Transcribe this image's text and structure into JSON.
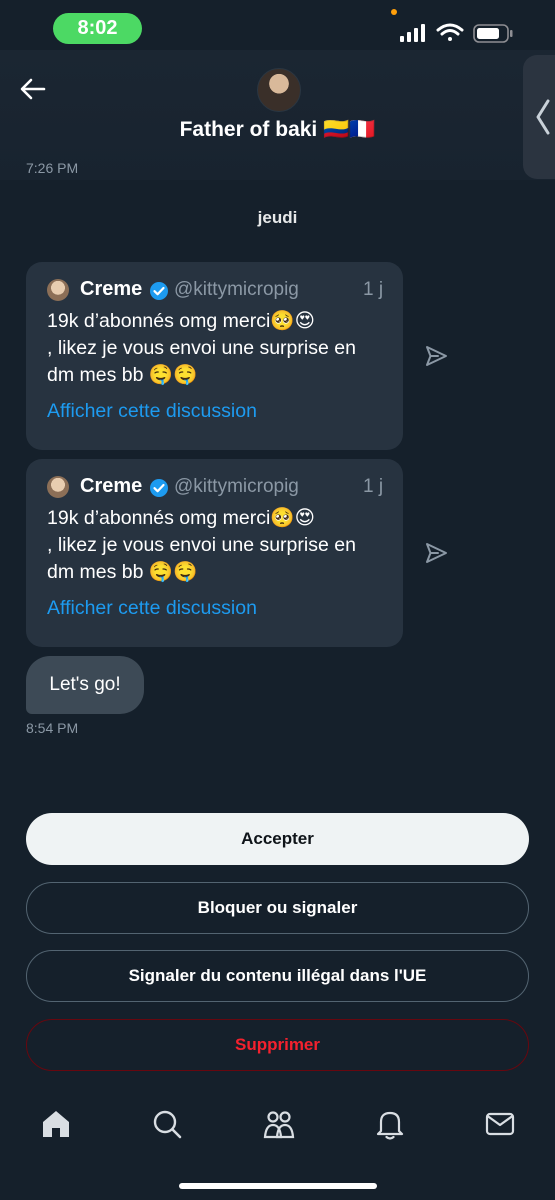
{
  "status_bar": {
    "time": "8:02"
  },
  "header": {
    "back_icon": "arrow-left-icon",
    "contact_name": "Father of baki 🇨🇴🇫🇷",
    "side_handle_icon": "chevron-left-icon"
  },
  "messages": {
    "timestamp_top": "7:26 PM",
    "day_label": "jeudi",
    "shared_tweets": [
      {
        "author": "Creme",
        "handle": "@kittymicropig",
        "age": "1 j",
        "text_line1": "19k d’abonnés omg merci🥺😍",
        "text_line2": ", likez je vous envoi une surprise en",
        "text_line3": "dm mes bb 🤤🤤",
        "link": "Afficher cette discussion"
      },
      {
        "author": "Creme",
        "handle": "@kittymicropig",
        "age": "1 j",
        "text_line1": "19k d’abonnés omg merci🥺😍",
        "text_line2": ", likez je vous envoi une surprise en",
        "text_line3": "dm mes bb 🤤🤤",
        "link": "Afficher cette discussion"
      }
    ],
    "bubble_text": "Let's go!",
    "timestamp_bottom": "8:54 PM"
  },
  "actions": {
    "accept": "Accepter",
    "block_report": "Bloquer ou signaler",
    "report_illegal": "Signaler du contenu illégal dans l'UE",
    "delete": "Supprimer"
  },
  "bottom_nav": [
    "home-icon",
    "search-icon",
    "communities-icon",
    "notifications-icon",
    "messages-icon"
  ],
  "colors": {
    "background": "#15202b",
    "accent": "#1d9bf0",
    "danger": "#f4212e",
    "card": "#273340"
  }
}
